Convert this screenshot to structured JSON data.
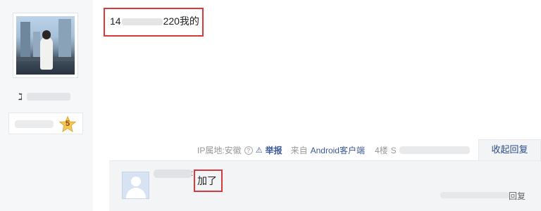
{
  "post": {
    "text_start": "14",
    "text_end": "220我的"
  },
  "author": {
    "name_char": "ℷ",
    "level": "5"
  },
  "meta": {
    "ip_location": "IP属地:安徽",
    "help": "?",
    "report_icon": "⚠",
    "report": "举报",
    "source_prefix": "来自",
    "client": "Android客户端",
    "floor": "4楼",
    "floor_extra": "S"
  },
  "reply_toggle": "收起回复",
  "reply": {
    "separator": ":",
    "content": "加了",
    "reply_link": "回复"
  },
  "colors": {
    "highlight": "#d63a3a",
    "link": "#3b5998"
  }
}
